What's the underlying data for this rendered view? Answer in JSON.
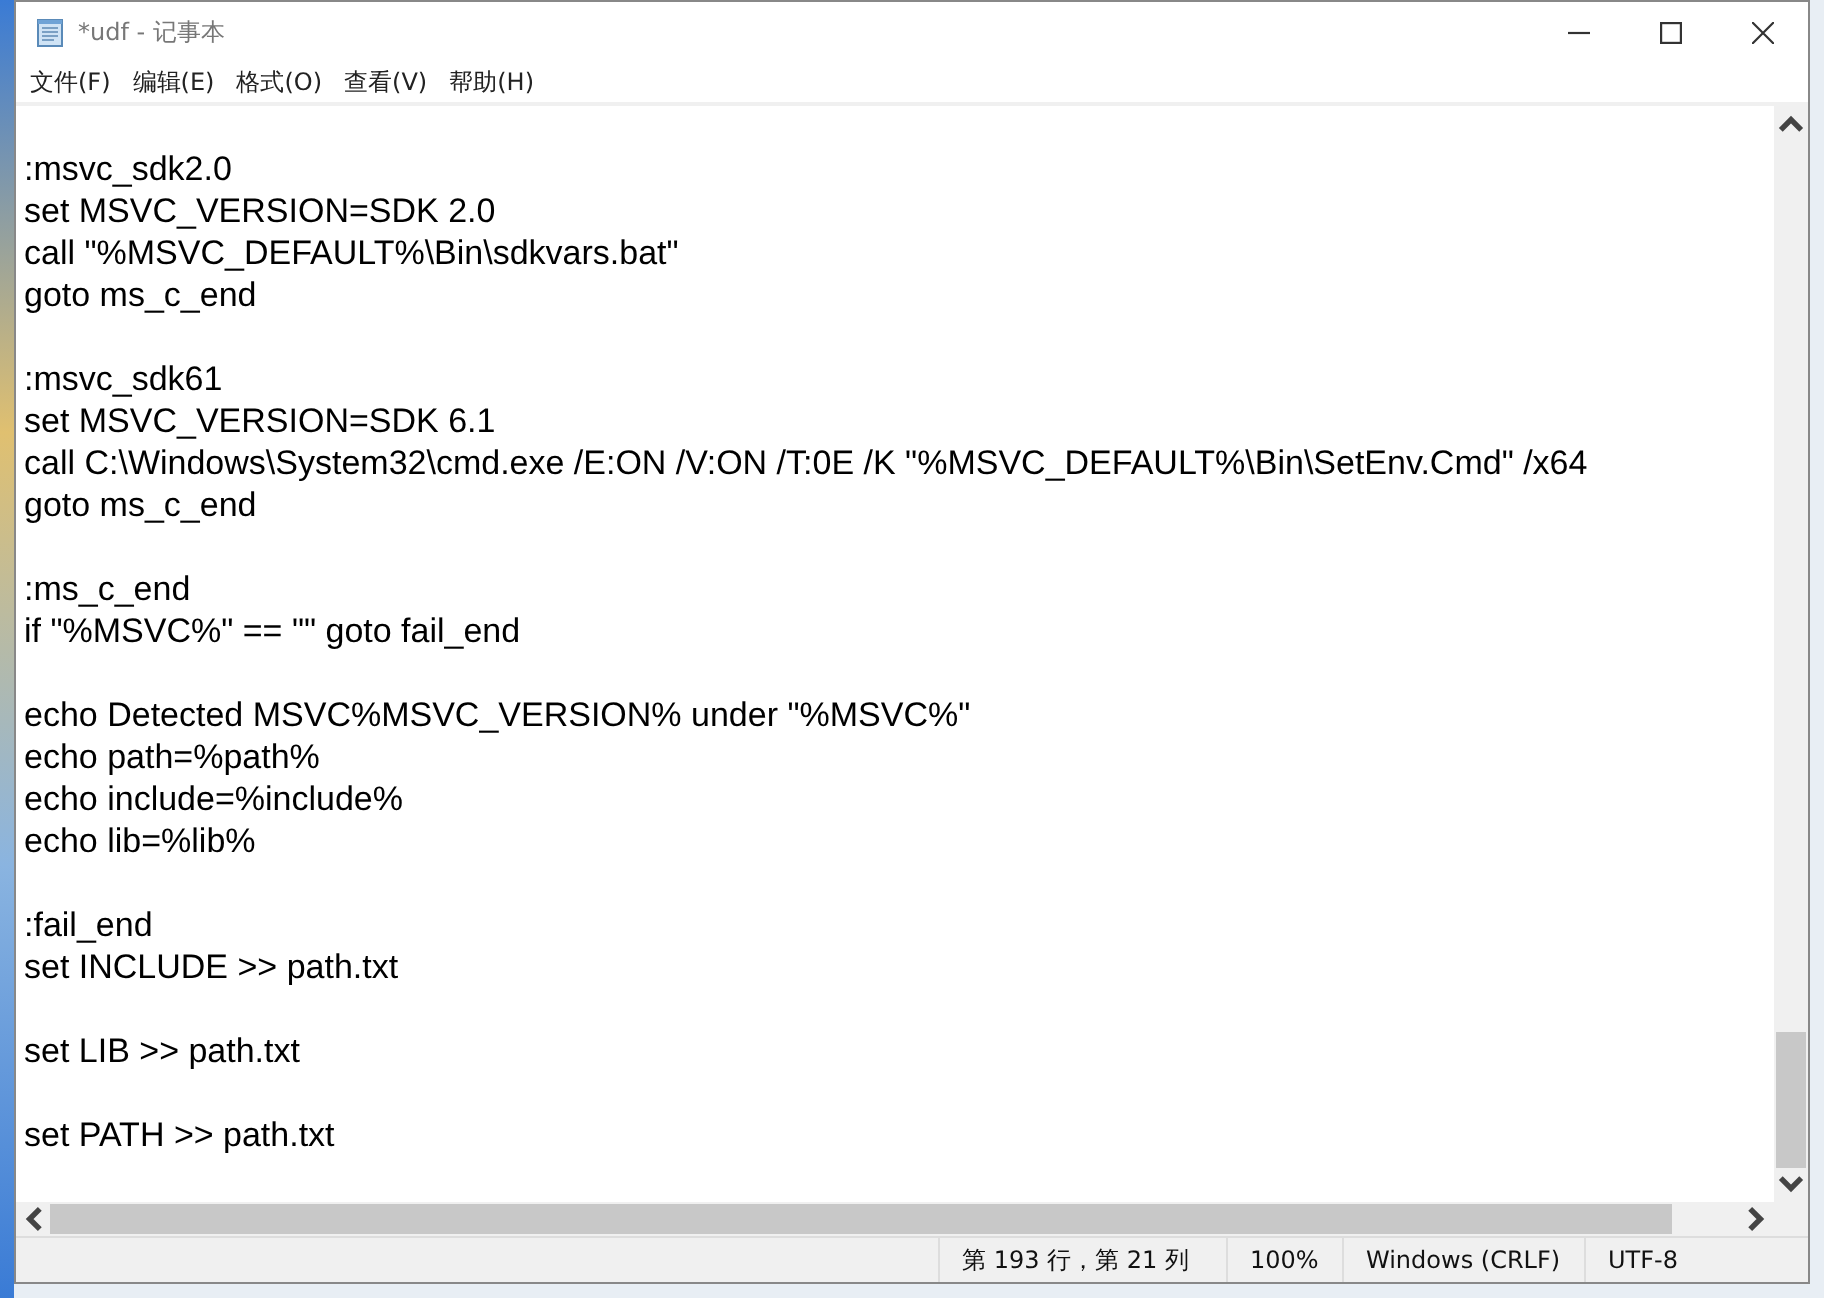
{
  "window": {
    "title": "*udf - 记事本"
  },
  "menu": [
    {
      "label": "文件(F)"
    },
    {
      "label": "编辑(E)"
    },
    {
      "label": "格式(O)"
    },
    {
      "label": "查看(V)"
    },
    {
      "label": "帮助(H)"
    }
  ],
  "editor": {
    "blocks": [
      [
        ":msvc_sdk2.0",
        "set MSVC_VERSION=SDK 2.0",
        "call \"%MSVC_DEFAULT%\\Bin\\sdkvars.bat\"",
        "goto ms_c_end"
      ],
      [
        ":msvc_sdk61",
        "set MSVC_VERSION=SDK 6.1",
        "call C:\\Windows\\System32\\cmd.exe /E:ON /V:ON /T:0E /K \"%MSVC_DEFAULT%\\Bin\\SetEnv.Cmd\" /x64",
        "goto ms_c_end"
      ],
      [
        ":ms_c_end",
        "if \"%MSVC%\" == \"\" goto fail_end"
      ],
      [
        "echo Detected MSVC%MSVC_VERSION% under \"%MSVC%\"",
        "echo path=%path%",
        "echo include=%include%",
        "echo lib=%lib%"
      ],
      [
        ":fail_end",
        "set INCLUDE >> path.txt"
      ],
      [
        "set LIB >> path.txt"
      ],
      [
        "set PATH >> path.txt"
      ]
    ]
  },
  "status_bar": {
    "position": "第 193 行，第 21 列",
    "zoom": "100%",
    "line_ending": "Windows (CRLF)",
    "encoding": "UTF-8"
  }
}
